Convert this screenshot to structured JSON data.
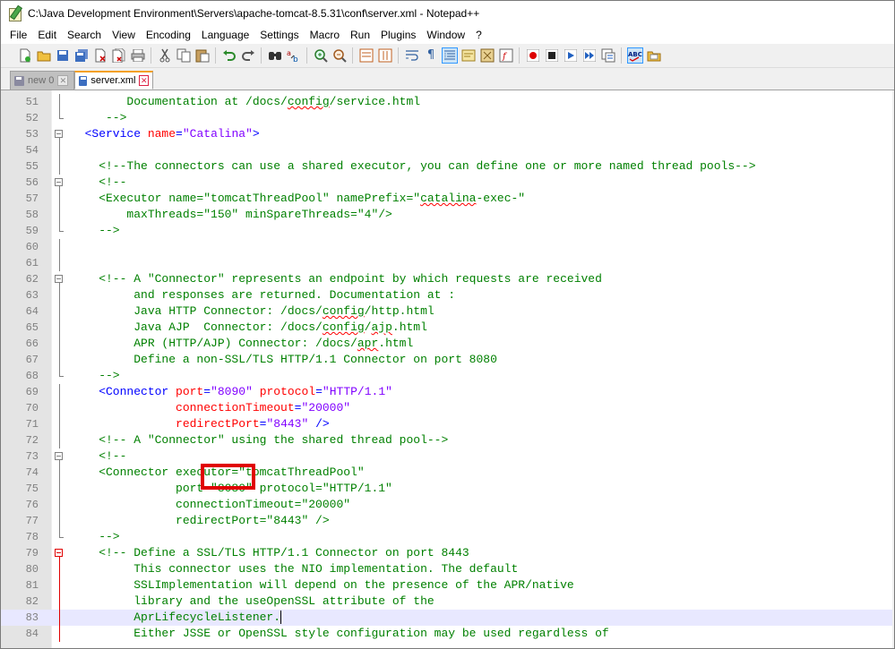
{
  "window": {
    "title": "C:\\Java Development Environment\\Servers\\apache-tomcat-8.5.31\\conf\\server.xml - Notepad++"
  },
  "menu": [
    "File",
    "Edit",
    "Search",
    "View",
    "Encoding",
    "Language",
    "Settings",
    "Macro",
    "Run",
    "Plugins",
    "Window",
    "?"
  ],
  "tabs": [
    {
      "label": "new 0",
      "active": false
    },
    {
      "label": "server.xml",
      "active": true
    }
  ],
  "editor": {
    "lines": [
      {
        "n": "51",
        "fold": "line",
        "seg": [
          {
            "t": "        Documentation at /docs/",
            "c": "com"
          },
          {
            "t": "config",
            "c": "com",
            "sq": true
          },
          {
            "t": "/service.html",
            "c": "com"
          }
        ]
      },
      {
        "n": "52",
        "fold": "end",
        "seg": [
          {
            "t": "     -->",
            "c": "com"
          }
        ]
      },
      {
        "n": "53",
        "fold": "open",
        "seg": [
          {
            "t": "  <Service ",
            "c": "tag"
          },
          {
            "t": "name",
            "c": "attr"
          },
          {
            "t": "=",
            "c": "tag"
          },
          {
            "t": "\"Catalina\"",
            "c": "val"
          },
          {
            "t": ">",
            "c": "tag"
          }
        ]
      },
      {
        "n": "54",
        "fold": "line",
        "seg": []
      },
      {
        "n": "55",
        "fold": "line",
        "seg": [
          {
            "t": "    <!--The connectors can use a shared executor, you can define one or more named thread pools-->",
            "c": "com"
          }
        ]
      },
      {
        "n": "56",
        "fold": "open",
        "seg": [
          {
            "t": "    <!--",
            "c": "com"
          }
        ]
      },
      {
        "n": "57",
        "fold": "line",
        "seg": [
          {
            "t": "    <Executor name=\"tomcatThreadPool\" namePrefix=\"",
            "c": "com"
          },
          {
            "t": "catalina",
            "c": "com",
            "sq": true
          },
          {
            "t": "-exec-\"",
            "c": "com"
          }
        ]
      },
      {
        "n": "58",
        "fold": "line",
        "seg": [
          {
            "t": "        maxThreads=\"150\" minSpareThreads=\"4\"/>",
            "c": "com"
          }
        ]
      },
      {
        "n": "59",
        "fold": "end",
        "seg": [
          {
            "t": "    -->",
            "c": "com"
          }
        ]
      },
      {
        "n": "60",
        "fold": "line",
        "seg": []
      },
      {
        "n": "61",
        "fold": "line",
        "seg": []
      },
      {
        "n": "62",
        "fold": "open",
        "seg": [
          {
            "t": "    <!-- A \"Connector\" represents an endpoint by which requests are received",
            "c": "com"
          }
        ]
      },
      {
        "n": "63",
        "fold": "line",
        "seg": [
          {
            "t": "         and responses are returned. Documentation at :",
            "c": "com"
          }
        ]
      },
      {
        "n": "64",
        "fold": "line",
        "seg": [
          {
            "t": "         Java HTTP Connector: /docs/",
            "c": "com"
          },
          {
            "t": "config",
            "c": "com",
            "sq": true
          },
          {
            "t": "/http.html",
            "c": "com"
          }
        ]
      },
      {
        "n": "65",
        "fold": "line",
        "seg": [
          {
            "t": "         Java AJP  Connector: /docs/",
            "c": "com"
          },
          {
            "t": "config",
            "c": "com",
            "sq": true
          },
          {
            "t": "/",
            "c": "com"
          },
          {
            "t": "ajp",
            "c": "com",
            "sq": true
          },
          {
            "t": ".html",
            "c": "com"
          }
        ]
      },
      {
        "n": "66",
        "fold": "line",
        "seg": [
          {
            "t": "         APR (HTTP/AJP) Connector: /docs/",
            "c": "com"
          },
          {
            "t": "apr",
            "c": "com",
            "sq": true
          },
          {
            "t": ".html",
            "c": "com"
          }
        ]
      },
      {
        "n": "67",
        "fold": "line",
        "seg": [
          {
            "t": "         Define a non-SSL/TLS HTTP/1.1 Connector on port 8080",
            "c": "com"
          }
        ]
      },
      {
        "n": "68",
        "fold": "end",
        "seg": [
          {
            "t": "    -->",
            "c": "com"
          }
        ]
      },
      {
        "n": "69",
        "fold": "line",
        "seg": [
          {
            "t": "    <Connector ",
            "c": "tag"
          },
          {
            "t": "port",
            "c": "attr"
          },
          {
            "t": "=",
            "c": "tag"
          },
          {
            "t": "\"8090\"",
            "c": "val"
          },
          {
            "t": " ",
            "c": "tag"
          },
          {
            "t": "protocol",
            "c": "attr"
          },
          {
            "t": "=",
            "c": "tag"
          },
          {
            "t": "\"HTTP/1.1\"",
            "c": "val"
          }
        ]
      },
      {
        "n": "70",
        "fold": "line",
        "seg": [
          {
            "t": "               ",
            "c": "tag"
          },
          {
            "t": "connectionTimeout",
            "c": "attr"
          },
          {
            "t": "=",
            "c": "tag"
          },
          {
            "t": "\"20000\"",
            "c": "val"
          }
        ]
      },
      {
        "n": "71",
        "fold": "line",
        "seg": [
          {
            "t": "               ",
            "c": "tag"
          },
          {
            "t": "redirectPort",
            "c": "attr"
          },
          {
            "t": "=",
            "c": "tag"
          },
          {
            "t": "\"8443\"",
            "c": "val"
          },
          {
            "t": " />",
            "c": "tag"
          }
        ]
      },
      {
        "n": "72",
        "fold": "line",
        "seg": [
          {
            "t": "    <!-- A \"Connector\" using the shared thread pool-->",
            "c": "com"
          }
        ]
      },
      {
        "n": "73",
        "fold": "open",
        "seg": [
          {
            "t": "    <!--",
            "c": "com"
          }
        ]
      },
      {
        "n": "74",
        "fold": "line",
        "seg": [
          {
            "t": "    <Connector executor=\"tomcatThreadPool\"",
            "c": "com"
          }
        ]
      },
      {
        "n": "75",
        "fold": "line",
        "seg": [
          {
            "t": "               port=\"8080\" protocol=\"HTTP/1.1\"",
            "c": "com"
          }
        ]
      },
      {
        "n": "76",
        "fold": "line",
        "seg": [
          {
            "t": "               connectionTimeout=\"20000\"",
            "c": "com"
          }
        ]
      },
      {
        "n": "77",
        "fold": "line",
        "seg": [
          {
            "t": "               redirectPort=\"8443\" />",
            "c": "com"
          }
        ]
      },
      {
        "n": "78",
        "fold": "end",
        "seg": [
          {
            "t": "    -->",
            "c": "com"
          }
        ]
      },
      {
        "n": "79",
        "fold": "open-red",
        "seg": [
          {
            "t": "    <!-- Define a SSL/TLS HTTP/1.1 Connector on port 8443",
            "c": "com"
          }
        ]
      },
      {
        "n": "80",
        "fold": "line-red",
        "seg": [
          {
            "t": "         This connector uses the NIO implementation. The default",
            "c": "com"
          }
        ]
      },
      {
        "n": "81",
        "fold": "line-red",
        "seg": [
          {
            "t": "         SSLImplementation will depend on the presence of the APR/native",
            "c": "com"
          }
        ]
      },
      {
        "n": "82",
        "fold": "line-red",
        "seg": [
          {
            "t": "         library and the useOpenSSL attribute of the",
            "c": "com"
          }
        ]
      },
      {
        "n": "83",
        "fold": "line-red",
        "current": true,
        "seg": [
          {
            "t": "         AprLifecycleListener.",
            "c": "com"
          }
        ]
      },
      {
        "n": "84",
        "fold": "line-red",
        "seg": [
          {
            "t": "         Either JSSE or OpenSSL style configuration may be used regardless of",
            "c": "com"
          }
        ]
      }
    ]
  }
}
